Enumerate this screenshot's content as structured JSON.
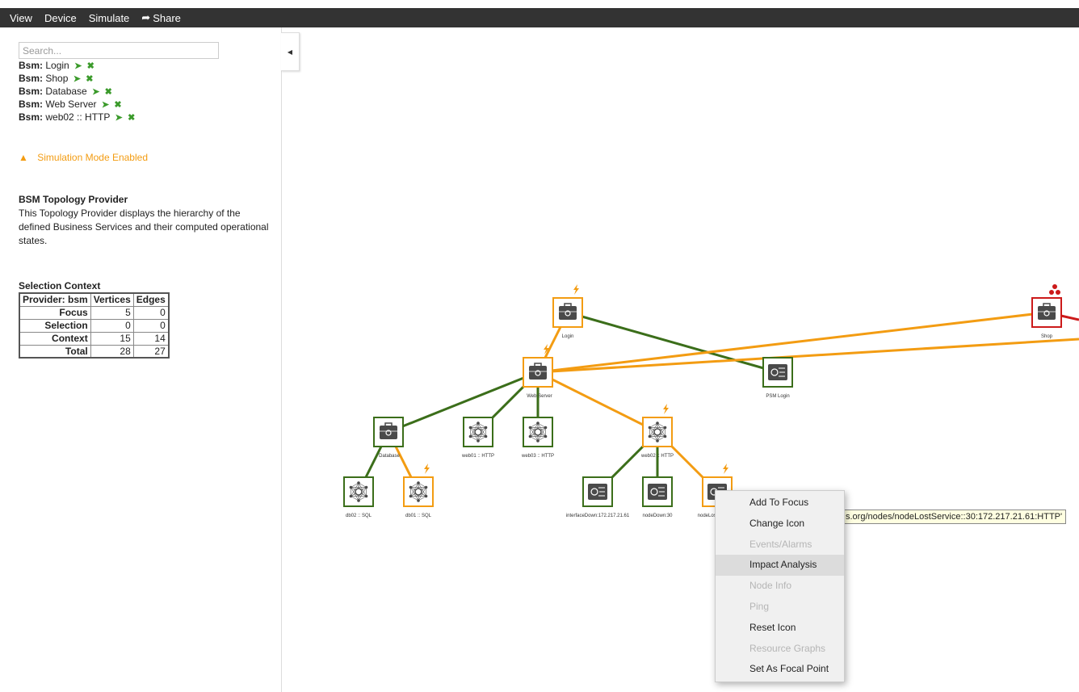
{
  "menubar": {
    "view": "View",
    "device": "Device",
    "simulate": "Simulate",
    "share": "Share"
  },
  "sidebar": {
    "search_placeholder": "Search...",
    "focus": [
      {
        "type": "Bsm:",
        "name": "Login"
      },
      {
        "type": "Bsm:",
        "name": "Shop"
      },
      {
        "type": "Bsm:",
        "name": "Database"
      },
      {
        "type": "Bsm:",
        "name": "Web Server"
      },
      {
        "type": "Bsm:",
        "name": "web02 :: HTTP"
      }
    ],
    "simulation_notice": "Simulation Mode Enabled",
    "provider_title": "BSM Topology Provider",
    "provider_desc": "This Topology Provider displays the hierarchy of the defined Business Services and their computed operational states.",
    "selection_title": "Selection Context",
    "table": {
      "headers": [
        "Provider: bsm",
        "Vertices",
        "Edges"
      ],
      "rows": [
        {
          "label": "Focus",
          "vertices": "5",
          "edges": "0"
        },
        {
          "label": "Selection",
          "vertices": "0",
          "edges": "0"
        },
        {
          "label": "Context",
          "vertices": "15",
          "edges": "14"
        },
        {
          "label": "Total",
          "vertices": "28",
          "edges": "27"
        }
      ]
    }
  },
  "graph": {
    "colors": {
      "green": "#3b6e1a",
      "orange": "#f39c12",
      "red": "#cc1a1a",
      "dark": "#4a4a4a"
    },
    "vertices": {
      "login": {
        "label": "Login",
        "status": "orange",
        "icon": "business-service-icon"
      },
      "shop": {
        "label": "Shop",
        "status": "red",
        "icon": "business-service-icon"
      },
      "webserver": {
        "label": "Web Server",
        "status": "orange",
        "icon": "business-service-icon"
      },
      "psmlogin": {
        "label": "PSM Login",
        "status": "green",
        "icon": "reduction-key-icon"
      },
      "database": {
        "label": "Database",
        "status": "green",
        "icon": "business-service-icon"
      },
      "web01": {
        "label": "web01 :: HTTP",
        "status": "green",
        "icon": "ip-service-icon"
      },
      "web03": {
        "label": "web03 :: HTTP",
        "status": "green",
        "icon": "ip-service-icon"
      },
      "web02": {
        "label": "web02 :: HTTP",
        "status": "orange",
        "icon": "ip-service-icon"
      },
      "db02": {
        "label": "db02 :: SQL",
        "status": "green",
        "icon": "ip-service-icon"
      },
      "db01": {
        "label": "db01 :: SQL",
        "status": "orange",
        "icon": "ip-service-icon"
      },
      "ifdown": {
        "label": "interfaceDown:172.217.21.61",
        "status": "green",
        "icon": "reduction-key-icon"
      },
      "nodedown": {
        "label": "nodeDown:30",
        "status": "green",
        "icon": "reduction-key-icon"
      },
      "nodelost": {
        "label": "nodeLostS",
        "status": "orange",
        "icon": "reduction-key-icon"
      }
    }
  },
  "tooltip": "s.org/nodes/nodeLostService::30:172.217.21.61:HTTP'",
  "context_menu": [
    {
      "label": "Add To Focus",
      "enabled": true
    },
    {
      "label": "Change Icon",
      "enabled": true
    },
    {
      "label": "Events/Alarms",
      "enabled": false
    },
    {
      "label": "Impact Analysis",
      "enabled": true,
      "hover": true
    },
    {
      "label": "Node Info",
      "enabled": false
    },
    {
      "label": "Ping",
      "enabled": false
    },
    {
      "label": "Reset Icon",
      "enabled": true
    },
    {
      "label": "Resource Graphs",
      "enabled": false
    },
    {
      "label": "Set As Focal Point",
      "enabled": true
    }
  ]
}
